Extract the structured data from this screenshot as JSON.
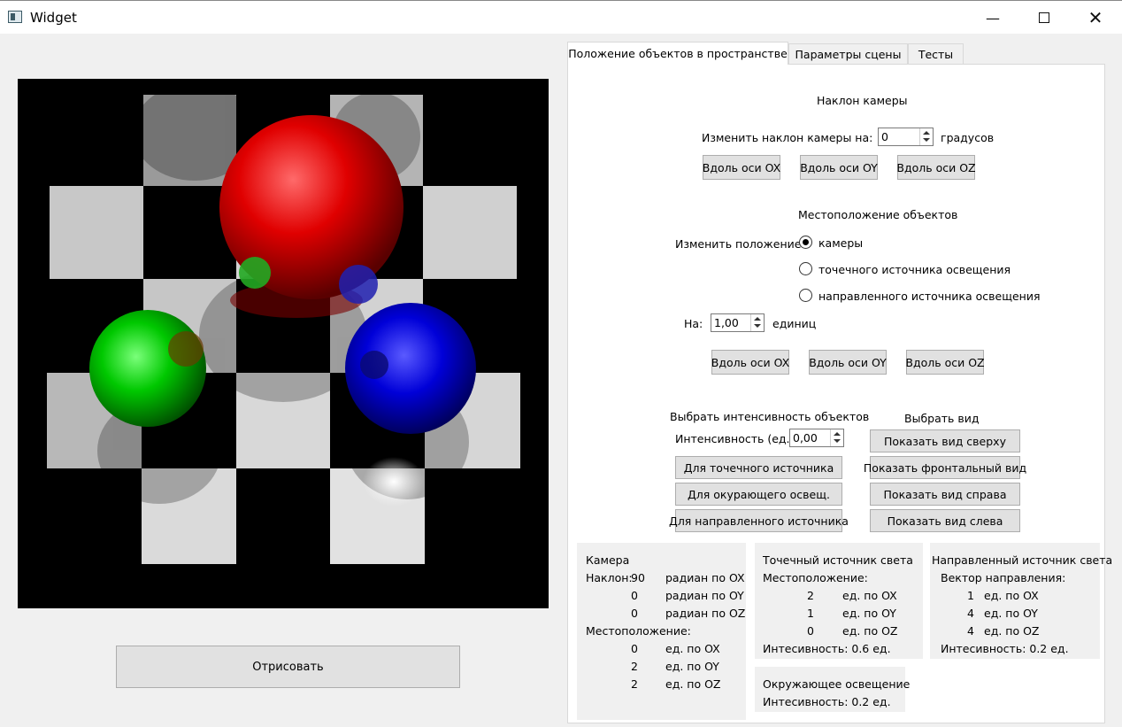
{
  "window": {
    "title": "Widget",
    "minimize_icon": "minimize-icon",
    "maximize_icon": "maximize-icon",
    "close_icon": "close-icon"
  },
  "draw_button": "Отрисовать",
  "tabs": [
    "Положение объектов в пространстве",
    "Параметры сцены",
    "Тесты"
  ],
  "camera_tilt": {
    "heading": "Наклон камеры",
    "label": "Изменить наклон камеры на:",
    "value": "0",
    "unit": "градусов",
    "buttons": [
      "Вдоль оси OX",
      "Вдоль оси OY",
      "Вдоль оси OZ"
    ]
  },
  "location": {
    "heading": "Местоположение объектов",
    "label": "Изменить положение:",
    "options": [
      "камеры",
      "точечного источника освещения",
      "направленного источника освещения"
    ],
    "selected": "камеры",
    "by_label": "На:",
    "value": "1,00",
    "unit": "единиц",
    "buttons": [
      "Вдоль оси OX",
      "Вдоль оси OY",
      "Вдоль оси OZ"
    ]
  },
  "intensity": {
    "heading": "Выбрать интенсивность объектов",
    "label": "Интенсивность (ед.)",
    "value": "0,00",
    "buttons": [
      "Для точечного источника",
      "Для окурающего освещ.",
      "Для направленного источника"
    ]
  },
  "view": {
    "heading": "Выбрать вид",
    "buttons": [
      "Показать вид сверху",
      "Показать фронтальный вид",
      "Показать вид справа",
      "Показать вид слева"
    ]
  },
  "camera_info": {
    "title": "Камера",
    "tilt_label": "Наклон:",
    "tilt": [
      {
        "value": "90",
        "unit": "радиан по OX"
      },
      {
        "value": "0",
        "unit": "радиан по OY"
      },
      {
        "value": "0",
        "unit": "радиан по OZ"
      }
    ],
    "position_label": "Местоположение:",
    "position": [
      {
        "value": "0",
        "unit": "ед. по OX"
      },
      {
        "value": "2",
        "unit": "ед. по OY"
      },
      {
        "value": "2",
        "unit": "ед. по OZ"
      }
    ]
  },
  "point_light_info": {
    "title": "Точечный источник света",
    "position_label": "Местоположение:",
    "position": [
      {
        "value": "2",
        "unit": "ед. по OX"
      },
      {
        "value": "1",
        "unit": "ед. по OY"
      },
      {
        "value": "0",
        "unit": "ед. по OZ"
      }
    ],
    "intensity": "Интесивность: 0.6 ед."
  },
  "directional_light_info": {
    "title": "Направленный источник света",
    "vector_label": "Вектор направления:",
    "vector": [
      {
        "value": "1",
        "unit": "ед. по OX"
      },
      {
        "value": "4",
        "unit": "ед. по OY"
      },
      {
        "value": "4",
        "unit": "ед. по OZ"
      }
    ],
    "intensity": "Интесивность: 0.2 ед."
  },
  "ambient_info": {
    "title": "Окружающее освещение",
    "intensity": "Интесивность: 0.2 ед."
  },
  "scene_colors": {
    "sphere_red": "#d80000",
    "sphere_green": "#00c400",
    "sphere_blue": "#0000d8",
    "floor_light": "#d6d6d6",
    "background": "#000000"
  }
}
